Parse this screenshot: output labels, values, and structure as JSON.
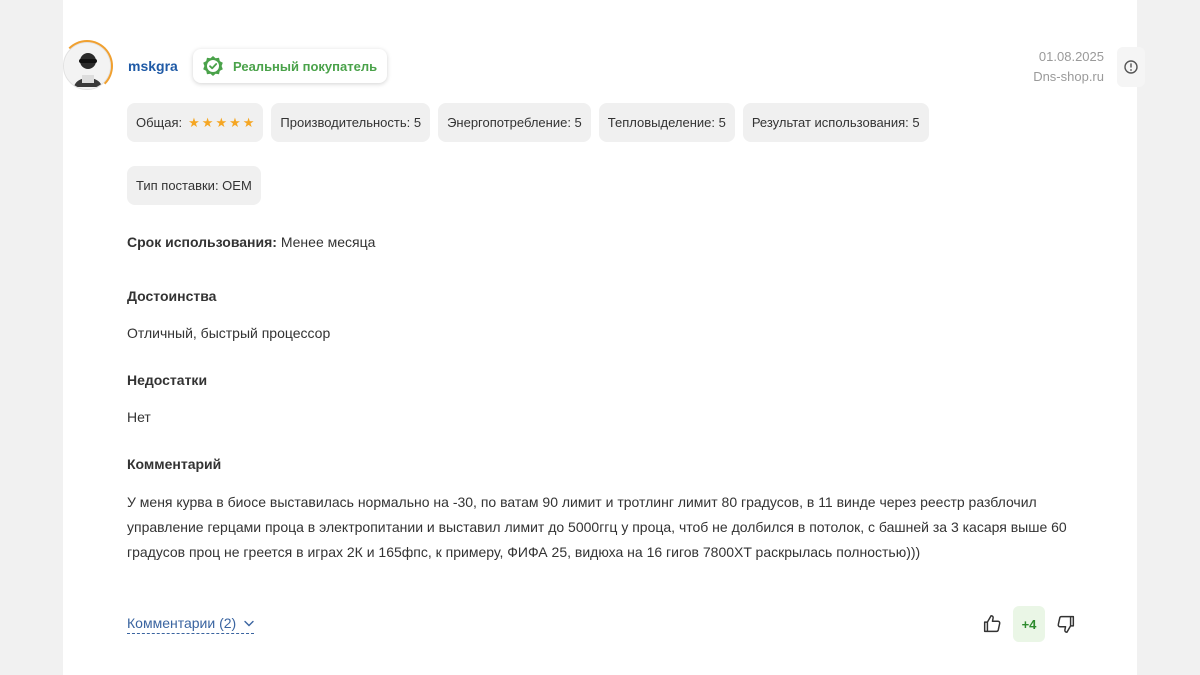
{
  "review": {
    "username": "mskgra",
    "buyer_badge": "Реальный покупатель",
    "date": "01.08.2025",
    "source": "Dns-shop.ru",
    "ratings": {
      "overall_label": "Общая:",
      "overall_stars": 5,
      "items": [
        "Производительность: 5",
        "Энергопотребление: 5",
        "Тепловыделение: 5",
        "Результат использования: 5"
      ]
    },
    "delivery_type": "Тип поставки: OEM",
    "usage_label": "Срок использования:",
    "usage_value": "Менее месяца",
    "pros_title": "Достоинства",
    "pros_text": "Отличный, быстрый процессор",
    "cons_title": "Недостатки",
    "cons_text": "Нет",
    "comment_title": "Комментарий",
    "comment_text": "У меня курва в биосе выставилась нормально на -30, по ватам 90 лимит и тротлинг лимит 80 градусов, в 11 винде через реестр разблочил управление герцами проца в электропитании и выставил лимит до 5000ггц у проца, чтоб не долбился в потолок, с башней за 3 касаря выше 60 градусов проц не греется в играх 2К и 165фпс, к примеру, ФИФА 25, видюха на 16 гигов 7800XT раскрылась полностью)))",
    "comments_link": "Комментарии (2)",
    "vote_count": "+4"
  },
  "colors": {
    "accent_link": "#1f5aa6",
    "badge_green": "#4aa24a",
    "star": "#f5a623",
    "vote_green": "#2e8b2e"
  },
  "icons": [
    "info-icon",
    "verified-check-icon",
    "chevron-down-icon",
    "thumbs-up-icon",
    "thumbs-down-icon",
    "star-icon"
  ]
}
